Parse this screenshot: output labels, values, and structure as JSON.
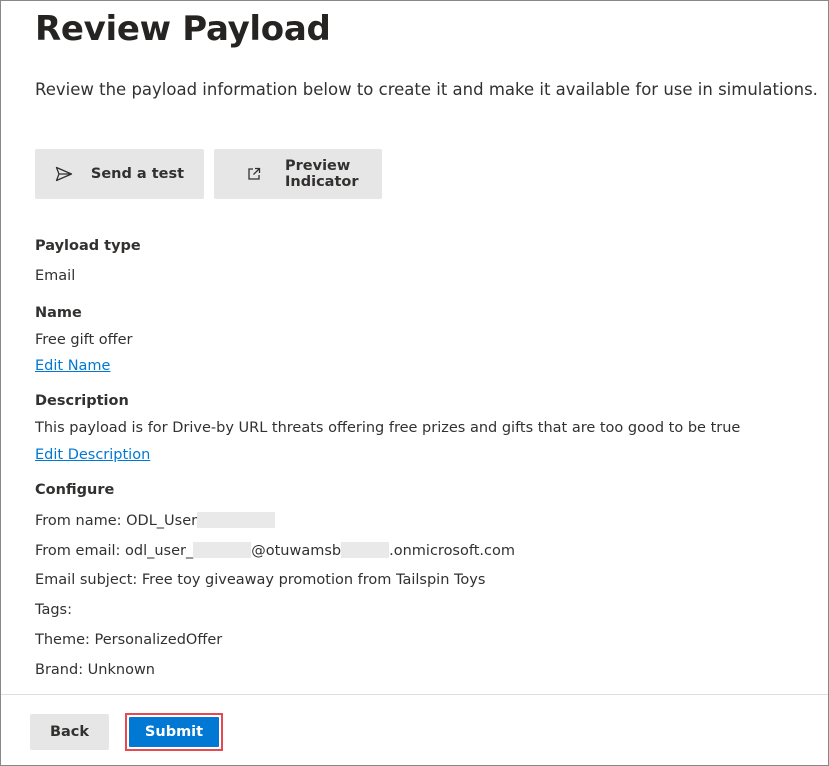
{
  "page": {
    "title": "Review Payload",
    "subtitle": "Review the payload information below to create it and make it available for use in simulations."
  },
  "actions": {
    "send_test_label": "Send a test",
    "send_test_icon": "send-icon",
    "preview_label": "Preview Indicator",
    "preview_icon": "open-external-icon"
  },
  "payload_type": {
    "label": "Payload type",
    "value": "Email"
  },
  "name": {
    "label": "Name",
    "value": "Free gift offer",
    "edit_link": "Edit Name"
  },
  "description": {
    "label": "Description",
    "value": "This payload is for Drive-by URL threats offering free prizes and gifts that are too good to be true",
    "edit_link": "Edit Description"
  },
  "configure": {
    "label": "Configure",
    "from_name_prefix": "From name: ODL_User",
    "from_email_prefix": "From email: odl_user_",
    "from_email_middle": "@otuwamsb",
    "from_email_suffix": ".onmicrosoft.com",
    "email_subject": "Email subject: Free toy giveaway promotion from Tailspin Toys",
    "tags": "Tags:",
    "theme": "Theme: PersonalizedOffer",
    "brand": "Brand: Unknown"
  },
  "footer": {
    "back_label": "Back",
    "submit_label": "Submit"
  },
  "colors": {
    "accent": "#0078d4",
    "highlight_border": "#e8484f",
    "button_gray": "#e6e6e6"
  }
}
